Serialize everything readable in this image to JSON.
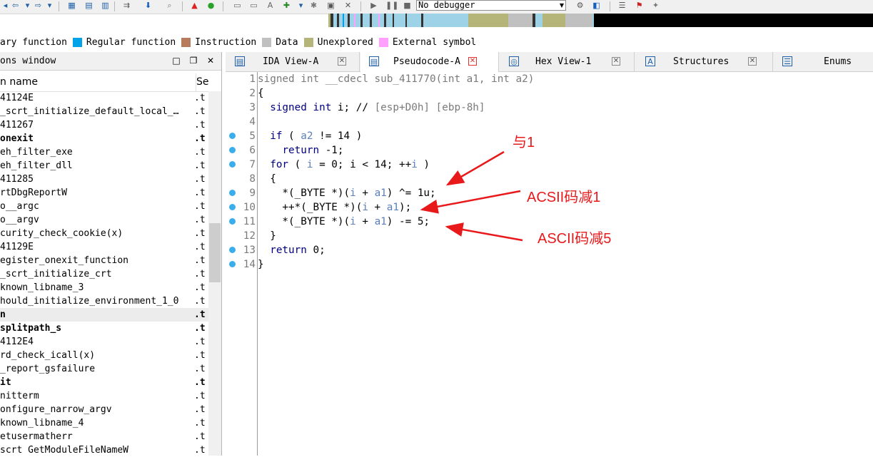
{
  "toolbar": {
    "debugger": "No debugger"
  },
  "legend": [
    {
      "label": "ary function",
      "color": "#ffffff"
    },
    {
      "label": "Regular function",
      "color": "#00a2e8"
    },
    {
      "label": "Instruction",
      "color": "#b77b5e"
    },
    {
      "label": "Data",
      "color": "#c0c0c0"
    },
    {
      "label": "Unexplored",
      "color": "#b5b57a"
    },
    {
      "label": "External symbol",
      "color": "#ffa0ff"
    }
  ],
  "functions_window": {
    "title": "ons window",
    "col_name": "n name",
    "col_segment": "Se",
    "rows": [
      {
        "name": "41124E",
        "seg": ".t",
        "bold": false
      },
      {
        "name": "_scrt_initialize_default_local_…",
        "seg": ".t",
        "bold": false
      },
      {
        "name": "411267",
        "seg": ".t",
        "bold": false
      },
      {
        "name": "onexit",
        "seg": ".t",
        "bold": true
      },
      {
        "name": "eh_filter_exe",
        "seg": ".t",
        "bold": false
      },
      {
        "name": "eh_filter_dll",
        "seg": ".t",
        "bold": false
      },
      {
        "name": "411285",
        "seg": ".t",
        "bold": false
      },
      {
        "name": "rtDbgReportW",
        "seg": ".t",
        "bold": false
      },
      {
        "name": "o__argc",
        "seg": ".t",
        "bold": false
      },
      {
        "name": "o__argv",
        "seg": ".t",
        "bold": false
      },
      {
        "name": "curity_check_cookie(x)",
        "seg": ".t",
        "bold": false
      },
      {
        "name": "41129E",
        "seg": ".t",
        "bold": false
      },
      {
        "name": "egister_onexit_function",
        "seg": ".t",
        "bold": false
      },
      {
        "name": "_scrt_initialize_crt",
        "seg": ".t",
        "bold": false
      },
      {
        "name": "known_libname_3",
        "seg": ".t",
        "bold": false
      },
      {
        "name": "hould_initialize_environment_1_0",
        "seg": ".t",
        "bold": false
      },
      {
        "name": "n",
        "seg": ".t",
        "bold": true
      },
      {
        "name": "splitpath_s",
        "seg": ".t",
        "bold": true
      },
      {
        "name": "4112E4",
        "seg": ".t",
        "bold": false
      },
      {
        "name": "rd_check_icall(x)",
        "seg": ".t",
        "bold": false
      },
      {
        "name": "_report_gsfailure",
        "seg": ".t",
        "bold": false
      },
      {
        "name": "it",
        "seg": ".t",
        "bold": true
      },
      {
        "name": "nitterm",
        "seg": ".t",
        "bold": false
      },
      {
        "name": "onfigure_narrow_argv",
        "seg": ".t",
        "bold": false
      },
      {
        "name": "known_libname_4",
        "seg": ".t",
        "bold": false
      },
      {
        "name": "etusermatherr",
        "seg": ".t",
        "bold": false
      },
      {
        "name": "scrt GetModuleFileNameW",
        "seg": ".t",
        "bold": false
      }
    ]
  },
  "tabs": [
    {
      "label": "IDA View-A",
      "icon": "listing-icon",
      "active": false
    },
    {
      "label": "Pseudocode-A",
      "icon": "pseudocode-icon",
      "active": true
    },
    {
      "label": "Hex View-1",
      "icon": "hex-icon",
      "active": false
    },
    {
      "label": "Structures",
      "icon": "structures-icon",
      "active": false
    },
    {
      "label": "Enums",
      "icon": "enums-icon",
      "active": false
    }
  ],
  "code_lines": [
    {
      "n": "1",
      "dot": false,
      "text": "signed int __cdecl sub_411770(int a1, int a2)"
    },
    {
      "n": "2",
      "dot": false,
      "text": "{"
    },
    {
      "n": "3",
      "dot": false,
      "text": "  signed int i; // [esp+D0h] [ebp-8h]"
    },
    {
      "n": "4",
      "dot": false,
      "text": ""
    },
    {
      "n": "5",
      "dot": true,
      "text": "  if ( a2 != 14 )"
    },
    {
      "n": "6",
      "dot": true,
      "text": "    return -1;"
    },
    {
      "n": "7",
      "dot": true,
      "text": "  for ( i = 0; i < 14; ++i )"
    },
    {
      "n": "8",
      "dot": false,
      "text": "  {"
    },
    {
      "n": "9",
      "dot": true,
      "text": "    *(_BYTE *)(i + a1) ^= 1u;"
    },
    {
      "n": "10",
      "dot": true,
      "text": "    ++*(_BYTE *)(i + a1);"
    },
    {
      "n": "11",
      "dot": true,
      "text": "    *(_BYTE *)(i + a1) -= 5;"
    },
    {
      "n": "12",
      "dot": false,
      "text": "  }"
    },
    {
      "n": "13",
      "dot": true,
      "text": "  return 0;"
    },
    {
      "n": "14",
      "dot": true,
      "text": "}"
    }
  ],
  "annotations": {
    "xor": "与1",
    "inc": "ACSII码减1",
    "sub": "ASCII码减5"
  },
  "colors": {
    "annotation": "#e8191b",
    "breakpoint_dot": "#3aaeea",
    "keyword": "#000080"
  }
}
